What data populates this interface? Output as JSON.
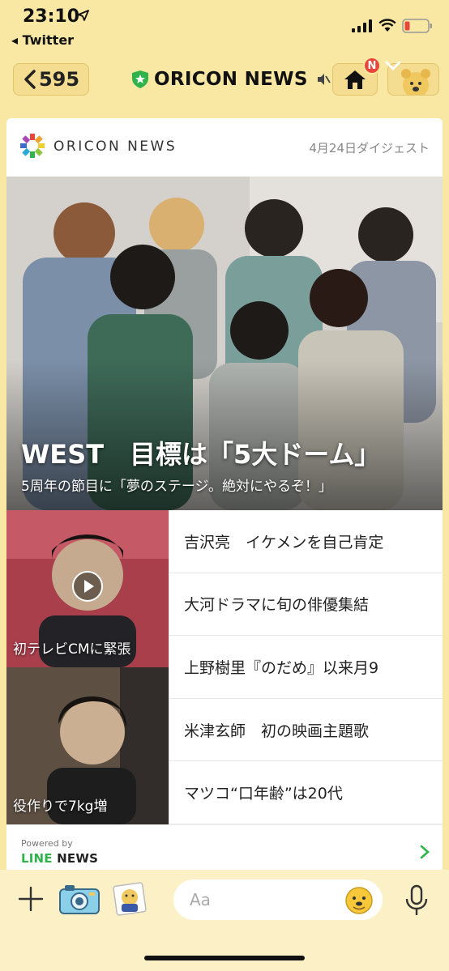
{
  "status_bar": {
    "time": "23:10",
    "back_app": "◂ Twitter"
  },
  "header": {
    "back_count": "595",
    "title": "ORICON NEWS",
    "notification_badge": "N"
  },
  "card": {
    "brand": "ORICON NEWS",
    "digest_label": "4月24日ダイジェスト",
    "hero": {
      "headline": "WEST　目標は「5大ドーム」",
      "subheadline": "5周年の節目に「夢のステージ。絶対にやるぞ！」"
    },
    "thumbnails": [
      {
        "caption": "初テレビCMに緊張"
      },
      {
        "caption": "役作りで7kg増"
      }
    ],
    "news_items": [
      "吉沢亮　イケメンを自己肯定",
      "大河ドラマに旬の俳優集結",
      "上野樹里『のだめ』以来月9",
      "米津玄師　初の映画主題歌",
      "マツコ“口年齢”は20代"
    ],
    "powered_by": "Powered by",
    "line_news": {
      "line": "LINE",
      "news": " NEWS"
    }
  },
  "input_bar": {
    "placeholder": "Aa"
  },
  "colors": {
    "background": "#f8e8a4",
    "line_green": "#2fb34a",
    "badge_red": "#e8463a"
  }
}
